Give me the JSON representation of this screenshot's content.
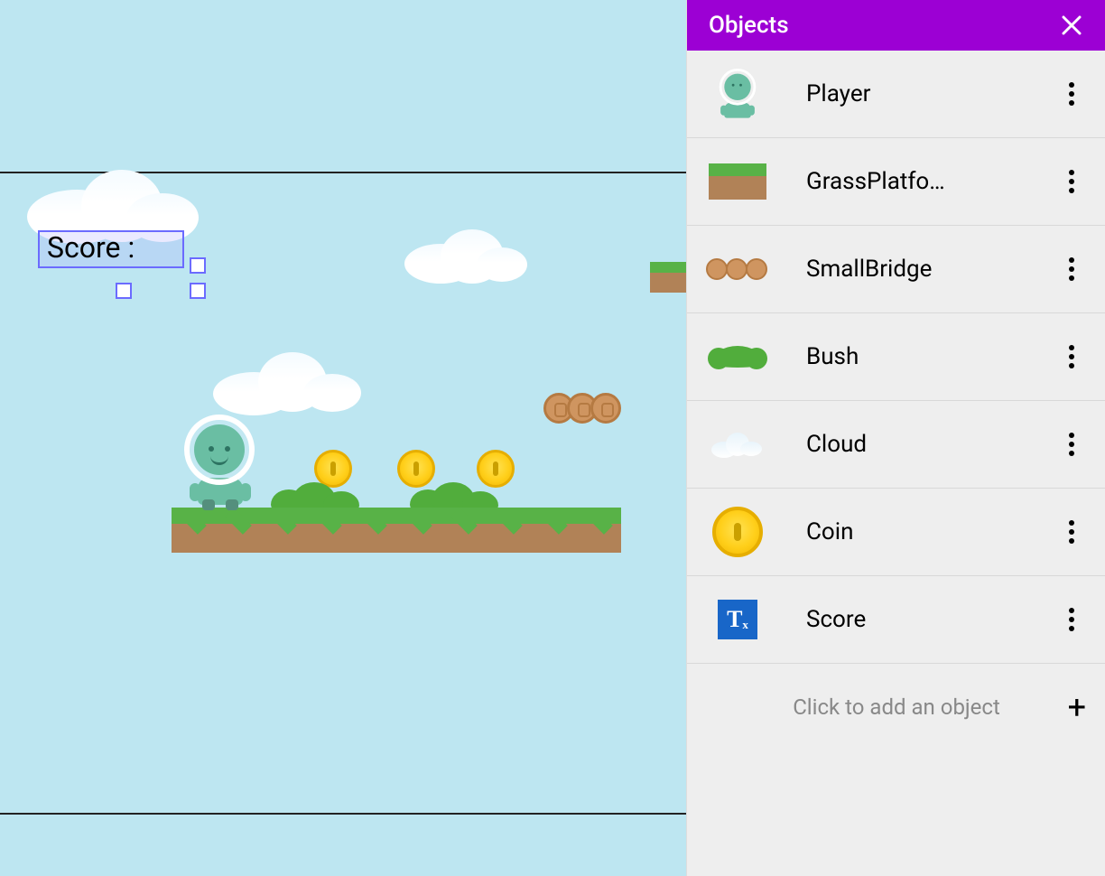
{
  "panel": {
    "title": "Objects",
    "add_hint": "Click to add an object",
    "items": [
      {
        "label": "Player"
      },
      {
        "label": "GrassPlatfo…"
      },
      {
        "label": "SmallBridge"
      },
      {
        "label": "Bush"
      },
      {
        "label": "Cloud"
      },
      {
        "label": "Coin"
      },
      {
        "label": "Score"
      }
    ]
  },
  "scene": {
    "score_label": "Score :"
  }
}
